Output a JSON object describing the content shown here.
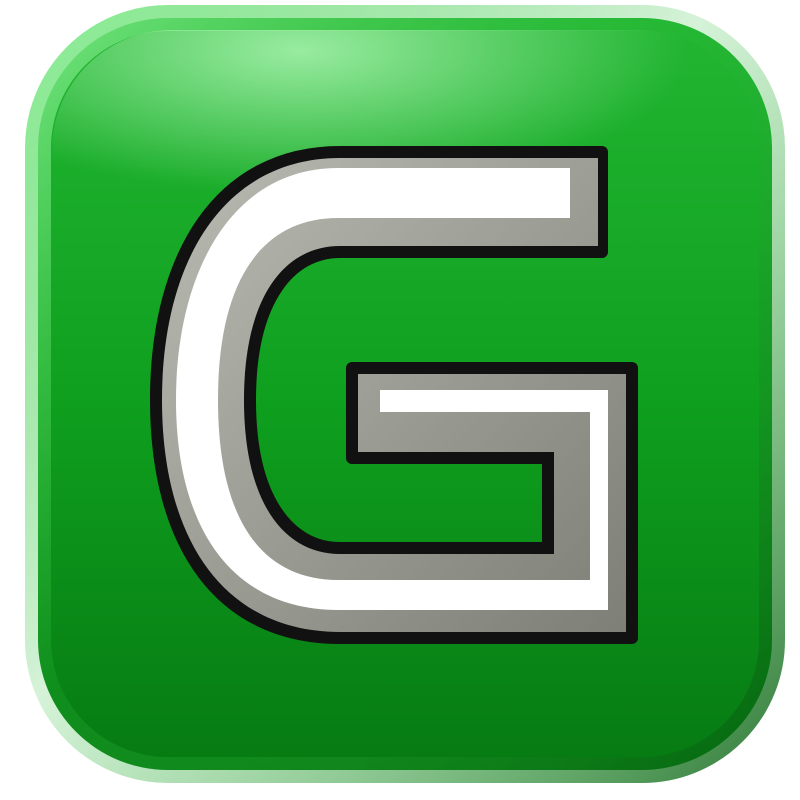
{
  "icon": {
    "name": "g-letter-icon",
    "letter": "G",
    "colors": {
      "tile_green": "#0fa01f",
      "tile_green_dark": "#067a12",
      "tile_highlight": "#6fe07a",
      "letter_face": "#ffffff",
      "letter_bevel": "#8f9189",
      "letter_outline": "#111111"
    }
  }
}
